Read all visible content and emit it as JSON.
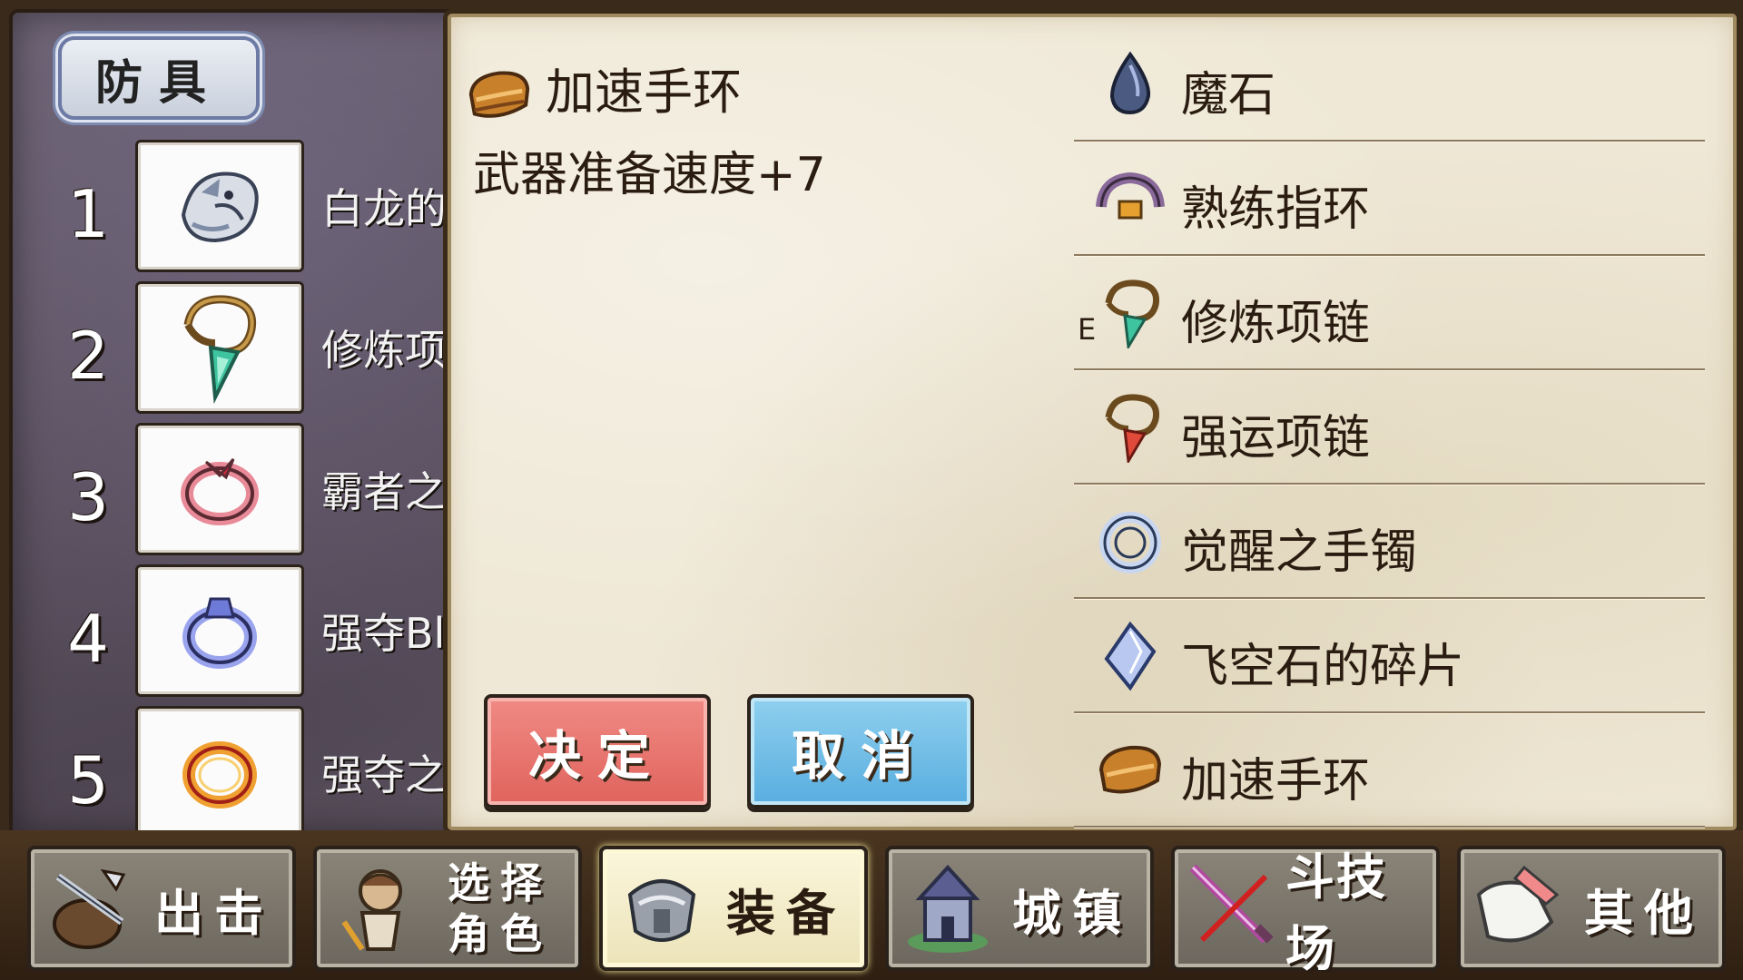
{
  "section_title": "防具",
  "slots": [
    {
      "num": "1",
      "name": "白龙的",
      "icon": "white-dragon-icon"
    },
    {
      "num": "2",
      "name": "修炼项",
      "icon": "training-necklace-icon"
    },
    {
      "num": "3",
      "name": "霸者之",
      "icon": "overlord-ring-icon"
    },
    {
      "num": "4",
      "name": "强夺Bl",
      "icon": "plunder-bl-ring-icon"
    },
    {
      "num": "5",
      "name": "强夺之",
      "icon": "plunder-ring-icon"
    }
  ],
  "detail": {
    "title": "加速手环",
    "description": "武器准备速度+7",
    "icon": "speed-bracelet-icon"
  },
  "buttons": {
    "confirm": "决定",
    "cancel": "取消"
  },
  "inventory": [
    {
      "name": "魔石",
      "icon": "magic-stone-icon",
      "mark": ""
    },
    {
      "name": "熟练指环",
      "icon": "skill-ring-icon",
      "mark": ""
    },
    {
      "name": "修炼项链",
      "icon": "training-necklace-icon",
      "mark": "E"
    },
    {
      "name": "强运项链",
      "icon": "luck-necklace-icon",
      "mark": ""
    },
    {
      "name": "觉醒之手镯",
      "icon": "awakening-bangle-icon",
      "mark": ""
    },
    {
      "name": "飞空石的碎片",
      "icon": "sky-stone-shard-icon",
      "mark": ""
    },
    {
      "name": "加速手环",
      "icon": "speed-bracelet-icon",
      "mark": ""
    }
  ],
  "nav": [
    {
      "label": "出击",
      "icon": "sortie-icon",
      "active": false
    },
    {
      "label_line1": "选择",
      "label_line2": "角色",
      "icon": "character-select-icon",
      "active": false
    },
    {
      "label": "装备",
      "icon": "equipment-icon",
      "active": true
    },
    {
      "label": "城镇",
      "icon": "town-icon",
      "active": false
    },
    {
      "label": "斗技场",
      "icon": "arena-icon",
      "active": false
    },
    {
      "label": "其他",
      "icon": "other-icon",
      "active": false
    }
  ],
  "colors": {
    "confirm_button": "#e0635d",
    "cancel_button": "#58ade0",
    "parchment": "#efe8d6",
    "nav_active": "#ece3b8"
  }
}
